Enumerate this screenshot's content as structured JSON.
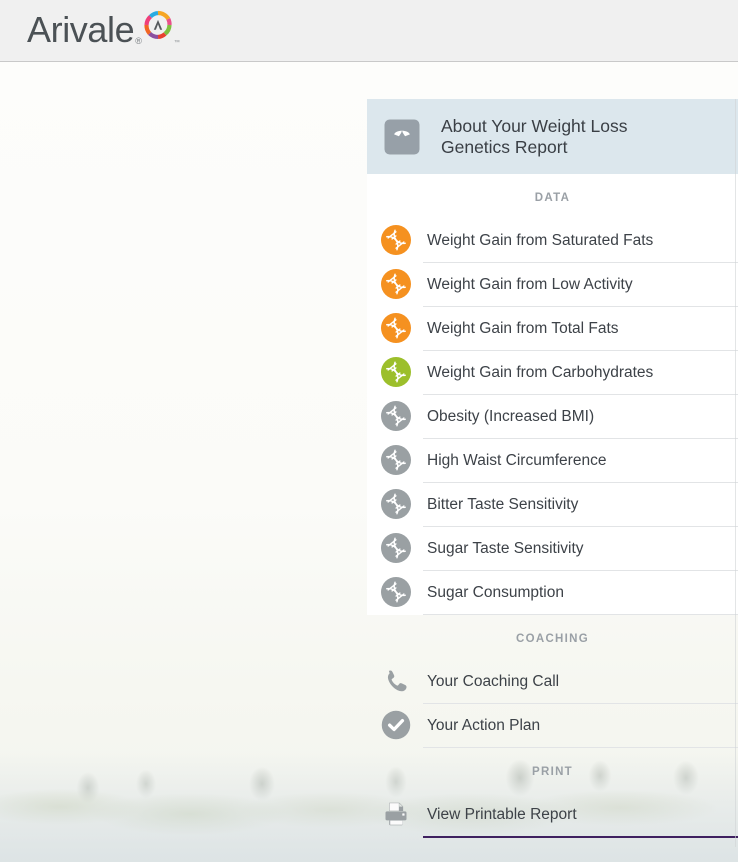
{
  "brand": {
    "name": "Arivale",
    "trademark": "®",
    "mark_trademark": "™",
    "logo_icon": "arivale-circle-logo",
    "bar_color": "#f0f0f0",
    "wordmark_color": "#4b5155"
  },
  "panel": {
    "header": {
      "title": "About Your Weight Loss Genetics Report",
      "title_line1": "About Your Weight Loss",
      "title_line2": "Genetics Report",
      "icon": "weight-scale-icon",
      "background_color": "#dce7ed",
      "icon_color": "#97a0a8"
    },
    "sections": [
      {
        "label": "DATA",
        "items": [
          {
            "label": "Weight Gain from Saturated Fats",
            "icon": "dna-icon",
            "icon_color": "#f59120"
          },
          {
            "label": "Weight Gain from Low Activity",
            "icon": "dna-icon",
            "icon_color": "#f59120"
          },
          {
            "label": "Weight Gain from Total Fats",
            "icon": "dna-icon",
            "icon_color": "#f59120"
          },
          {
            "label": "Weight Gain from Carbohydrates",
            "icon": "dna-icon",
            "icon_color": "#9cbf2b"
          },
          {
            "label": "Obesity (Increased BMI)",
            "icon": "dna-icon",
            "icon_color": "#9aa0a3"
          },
          {
            "label": "High Waist Circumference",
            "icon": "dna-icon",
            "icon_color": "#9aa0a3"
          },
          {
            "label": "Bitter Taste Sensitivity",
            "icon": "dna-icon",
            "icon_color": "#9aa0a3"
          },
          {
            "label": "Sugar Taste Sensitivity",
            "icon": "dna-icon",
            "icon_color": "#9aa0a3"
          },
          {
            "label": "Sugar Consumption",
            "icon": "dna-icon",
            "icon_color": "#9aa0a3"
          }
        ]
      },
      {
        "label": "COACHING",
        "items": [
          {
            "label": "Your Coaching Call",
            "icon": "phone-icon",
            "icon_color": "#9aa0a3"
          },
          {
            "label": "Your Action Plan",
            "icon": "check-circle-icon",
            "icon_color": "#9aa0a3"
          }
        ]
      },
      {
        "label": "PRINT",
        "items": [
          {
            "label": "View Printable Report",
            "icon": "printer-icon",
            "icon_color": "#9aa0a3"
          }
        ]
      }
    ],
    "accent_underline_color": "#3f2160",
    "divider_color": "#e2e4e6",
    "label_color": "#9aa0a6"
  }
}
